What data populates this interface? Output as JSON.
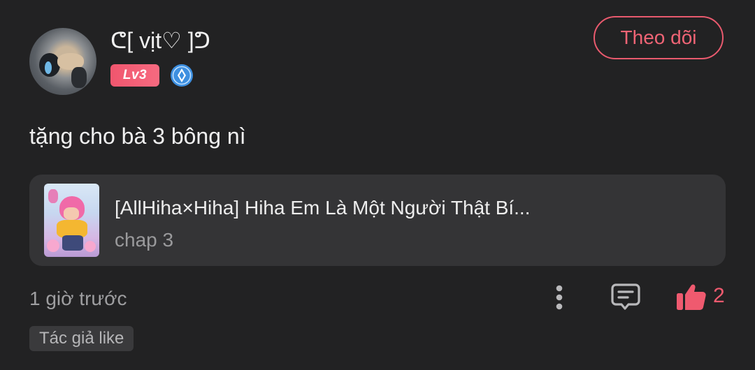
{
  "user": {
    "name": "ᕦ[ vịt♡ ]ᕤ",
    "level": "Lv3"
  },
  "actions": {
    "follow_label": "Theo dõi"
  },
  "comment": {
    "text": "tặng cho bà 3 bông nì",
    "time": "1 giờ trước",
    "like_count": "2",
    "author_like_label": "Tác giả like"
  },
  "manga": {
    "title": "[AllHiha×Hiha] Hiha Em Là Một Người Thật Bí...",
    "chapter": "chap 3"
  },
  "icons": {
    "rank": "rank-badge-icon",
    "more": "more-vertical-icon",
    "reply": "comment-icon",
    "like": "thumbs-up-icon"
  },
  "colors": {
    "background": "#222223",
    "accent": "#ef5a6f",
    "card": "#343436",
    "rank_blue": "#3d8fe0"
  }
}
